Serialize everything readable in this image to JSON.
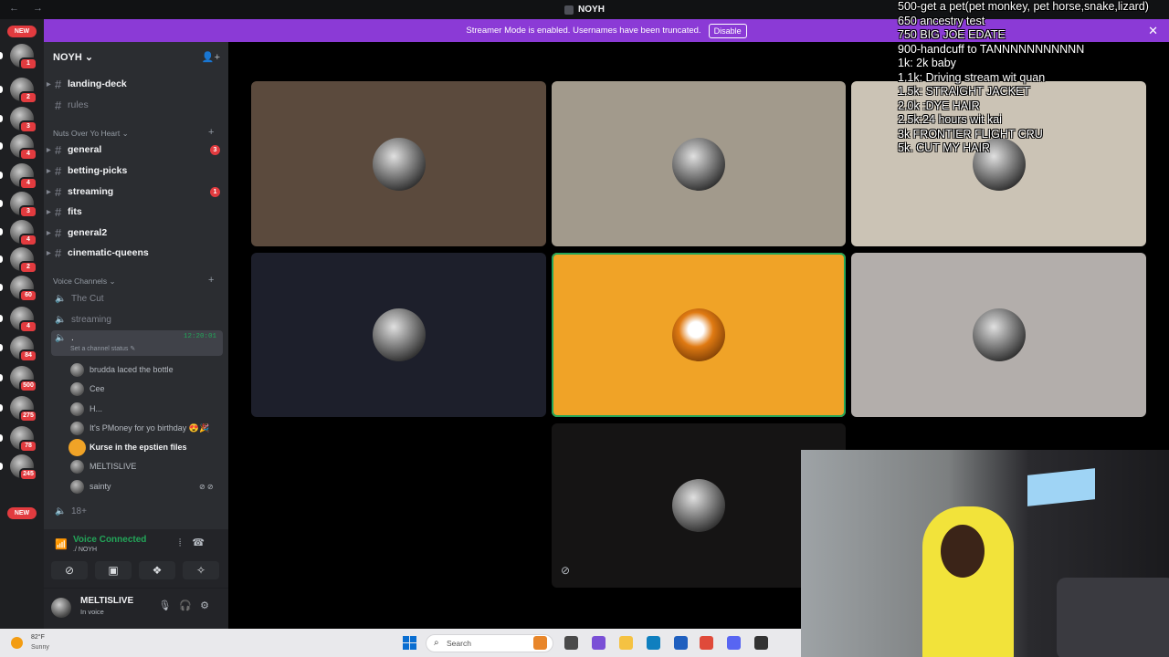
{
  "window": {
    "title": "NOYH"
  },
  "banner": {
    "text": "Streamer Mode is enabled. Usernames have been truncated.",
    "disable_label": "Disable"
  },
  "rail": {
    "top_badge": "NEW",
    "bottom_badge": "NEW",
    "servers": [
      {
        "badge": "1"
      },
      {
        "badge": "2"
      },
      {
        "badge": "3"
      },
      {
        "badge": "4"
      },
      {
        "badge": "4"
      },
      {
        "badge": "3"
      },
      {
        "badge": "4"
      },
      {
        "badge": "2"
      },
      {
        "badge": "60"
      },
      {
        "badge": "4"
      },
      {
        "badge": "84"
      },
      {
        "badge": "500"
      },
      {
        "badge": "275"
      },
      {
        "badge": "78"
      },
      {
        "badge": "245"
      }
    ]
  },
  "sidebar": {
    "server_name": "NOYH",
    "text_channels_top": [
      {
        "name": "landing-deck",
        "unread": true
      },
      {
        "name": "rules",
        "unread": false
      }
    ],
    "category_1": "Nuts Over Yo Heart",
    "channels": [
      {
        "name": "general",
        "badge": "3"
      },
      {
        "name": "betting-picks",
        "badge": ""
      },
      {
        "name": "streaming",
        "badge": "1"
      },
      {
        "name": "fits",
        "badge": ""
      },
      {
        "name": "general2",
        "badge": ""
      },
      {
        "name": "cinematic-queens",
        "badge": ""
      }
    ],
    "category_2": "Voice Channels",
    "voice_channels": [
      {
        "name": "The Cut"
      },
      {
        "name": "streaming"
      }
    ],
    "active_voice": {
      "name": ".",
      "timer": "12:20:01",
      "status_hint": "Set a channel status"
    },
    "members": [
      {
        "name": "brudda laced the bottle",
        "speaking": false
      },
      {
        "name": "Cee",
        "speaking": false
      },
      {
        "name": "H...",
        "speaking": false
      },
      {
        "name": "It's PMoney for yo birthday 😍🎉",
        "speaking": false
      },
      {
        "name": "Kurse in the epstien files",
        "speaking": true
      },
      {
        "name": "MELTISLIVE",
        "speaking": false
      },
      {
        "name": "sainty",
        "speaking": false
      }
    ],
    "last_voice": "18+"
  },
  "voice_panel": {
    "status": "Voice Connected",
    "location": "./ NOYH"
  },
  "user": {
    "name": "MELTISLIVE",
    "status": "In voice"
  },
  "stage": {
    "tiles": [
      {
        "color": "#5b4a3d",
        "speaking": false
      },
      {
        "color": "#a29a8c",
        "speaking": false
      },
      {
        "color": "#cbc3b5",
        "speaking": false
      },
      {
        "color": "#1d1f2b",
        "speaking": false
      },
      {
        "color": "#f0a327",
        "speaking": true
      },
      {
        "color": "#b3aeab",
        "speaking": false
      },
      {
        "color": "#151414",
        "speaking": false
      }
    ]
  },
  "goals": [
    "500-get a pet(pet monkey, pet horse,snake,lizard)",
    "650 ancestry test",
    "750 BIG JOE EDATE",
    "900-handcuff to TANNNNNNNNNNN",
    "1k: 2k baby",
    "1.1k: Driving stream wit quan",
    "1.5k: STRAIGHT JACKET",
    "2.0k :DYE HAIR",
    "2.5k:24 hours wit kai",
    "3k FRONTIER FLIGHT CRU",
    "5k. CUT MY HAIR"
  ],
  "taskbar": {
    "weather_temp": "82°F",
    "weather_cond": "Sunny",
    "search_placeholder": "Search",
    "apps": [
      "#e8862a",
      "#4a4a4a",
      "#7a4fd6",
      "#f5c242",
      "#0f7fbf",
      "#1f5fbf",
      "#e04a3a",
      "#5865f2",
      "#333333"
    ]
  },
  "colors": {
    "accent_purple": "#8b3ad6",
    "online_green": "#23a559",
    "badge_red": "#e23b3f"
  }
}
